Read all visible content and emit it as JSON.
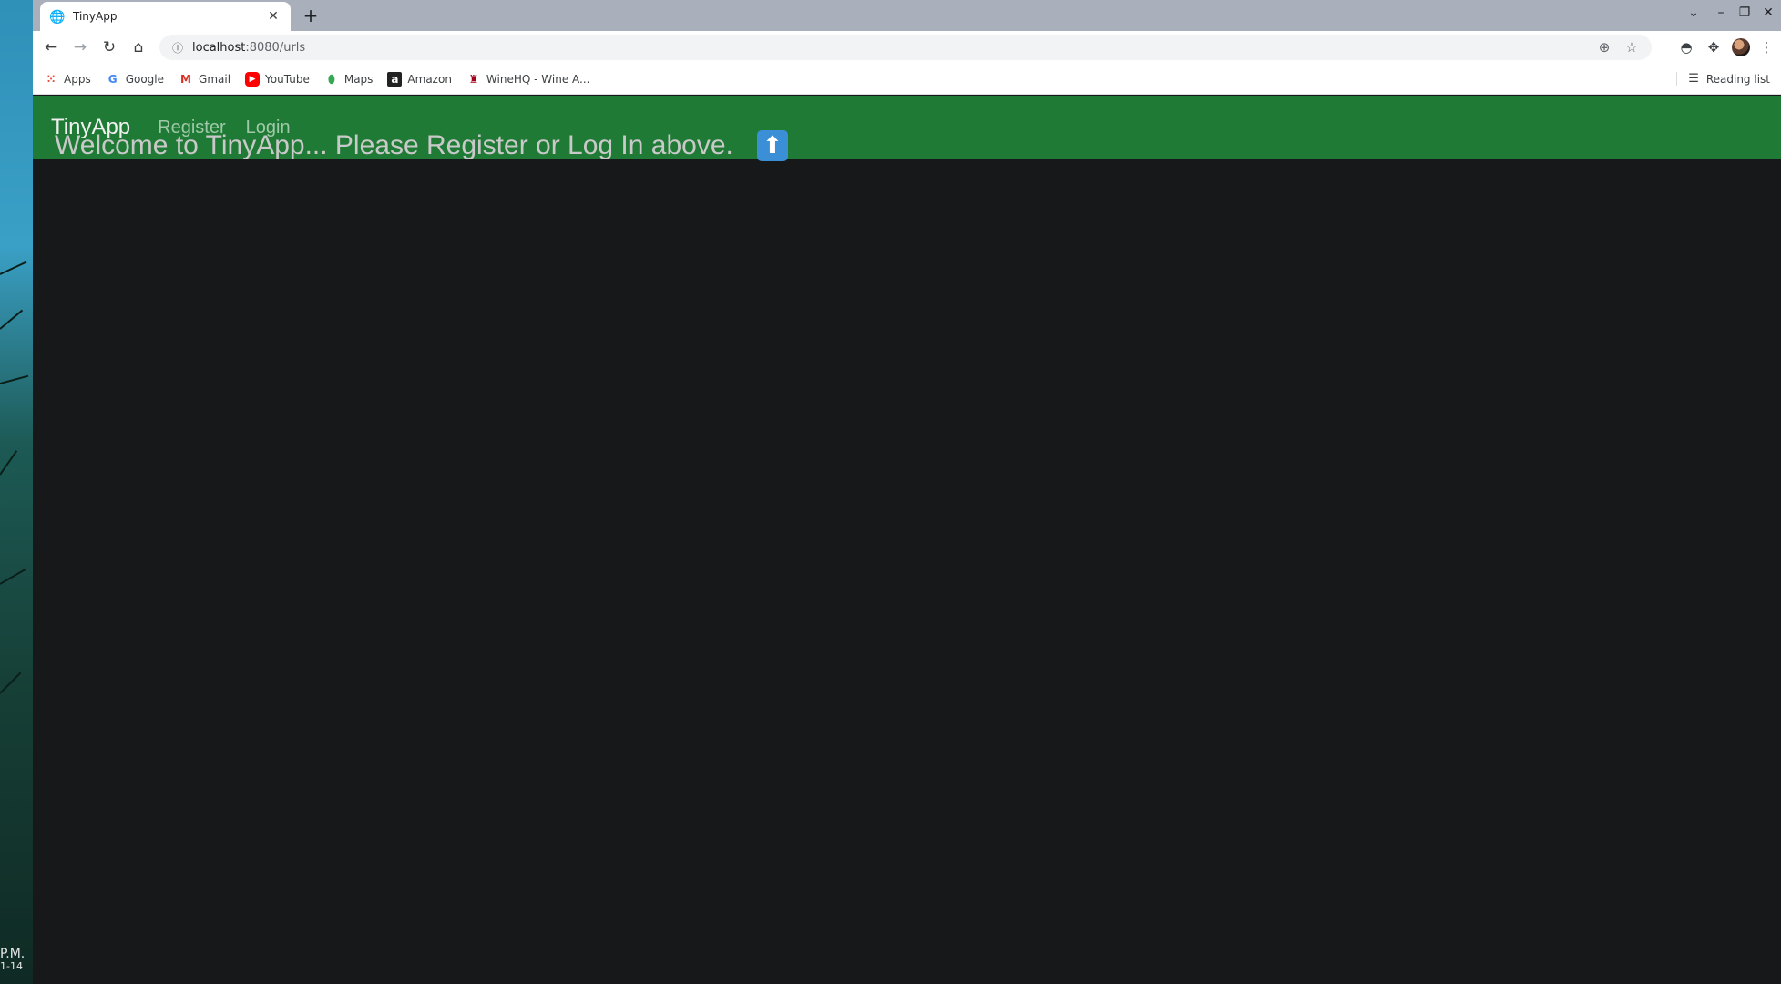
{
  "desktop": {
    "clock_time": "P.M.",
    "clock_date": "1-14"
  },
  "browser": {
    "tab": {
      "title": "TinyApp"
    },
    "address_bar": {
      "host": "localhost",
      "path": ":8080/urls"
    },
    "bookmarks": [
      {
        "label": "Apps",
        "icon": "apps-grid-icon"
      },
      {
        "label": "Google",
        "icon": "google-icon"
      },
      {
        "label": "Gmail",
        "icon": "gmail-icon"
      },
      {
        "label": "YouTube",
        "icon": "youtube-icon"
      },
      {
        "label": "Maps",
        "icon": "maps-icon"
      },
      {
        "label": "Amazon",
        "icon": "amazon-icon"
      },
      {
        "label": "WineHQ - Wine A...",
        "icon": "winehq-icon"
      }
    ],
    "reading_list": "Reading list"
  },
  "app": {
    "brand": "TinyApp",
    "nav": {
      "register": "Register",
      "login": "Login"
    },
    "welcome": "Welcome to TinyApp... Please Register or Log In above.",
    "arrow_symbol": "⬆"
  },
  "colors": {
    "navbar": "#1f7a35",
    "page_bg": "#17181a",
    "welcome_text": "#c9c9c9"
  }
}
